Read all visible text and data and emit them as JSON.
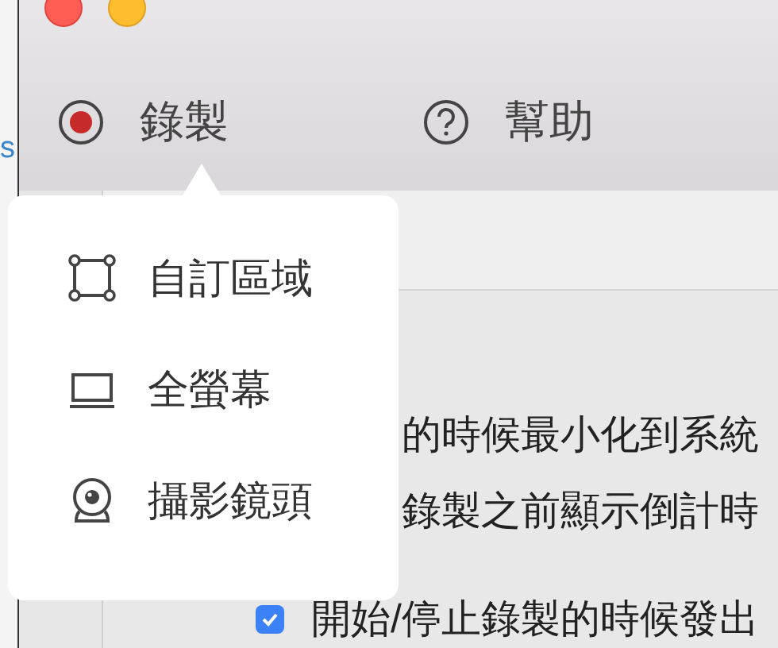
{
  "background_window": {
    "text": "s"
  },
  "toolbar": [
    {
      "kind": "record",
      "label": "錄製"
    },
    {
      "kind": "help",
      "label": "幫助"
    }
  ],
  "menu": {
    "items": [
      {
        "kind": "region",
        "label": "自訂區域"
      },
      {
        "kind": "screen",
        "label": "全螢幕"
      },
      {
        "kind": "camera",
        "label": "攝影鏡頭"
      }
    ]
  },
  "settings": [
    {
      "text": "的時候最小化到系統"
    },
    {
      "text": "錄製之前顯示倒計時"
    },
    {
      "text": "開始/停止錄製的時候發出",
      "checked": true
    }
  ]
}
